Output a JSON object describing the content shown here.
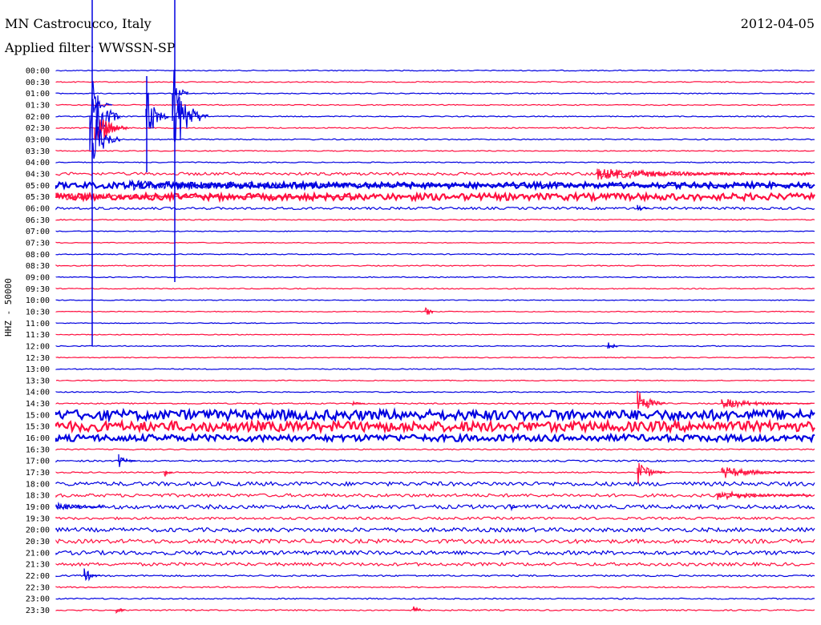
{
  "header": {
    "station": "MN Castrocucco, Italy",
    "filter": "Applied filter: WWSSN-SP",
    "date": "2012-04-05",
    "channel_label": "HHZ - 50000"
  },
  "colors": {
    "trace_a": "#0000e0",
    "trace_b": "#ff1040"
  },
  "chart_data": {
    "type": "helicorder",
    "title": "MN Castrocucco, Italy",
    "subtitle": "Applied filter: WWSSN-SP",
    "date": "2012-04-05",
    "ylabel": "HHZ - 50000",
    "row_labels": [
      "00:00",
      "00:30",
      "01:00",
      "01:30",
      "02:00",
      "02:30",
      "03:00",
      "03:30",
      "04:00",
      "04:30",
      "05:00",
      "05:30",
      "06:00",
      "06:30",
      "07:00",
      "07:30",
      "08:00",
      "08:30",
      "09:00",
      "09:30",
      "10:00",
      "10:30",
      "11:00",
      "11:30",
      "12:00",
      "12:30",
      "13:00",
      "13:30",
      "14:00",
      "14:30",
      "15:00",
      "15:30",
      "16:00",
      "16:30",
      "17:00",
      "17:30",
      "18:00",
      "18:30",
      "19:00",
      "19:30",
      "20:00",
      "20:30",
      "21:00",
      "21:30",
      "22:00",
      "22:30",
      "23:00",
      "23:30"
    ],
    "noise_level": [
      0.6,
      0.6,
      0.6,
      0.6,
      0.6,
      0.7,
      0.7,
      0.6,
      0.6,
      1.8,
      3.5,
      4,
      1.5,
      0.6,
      0.5,
      0.5,
      0.6,
      0.6,
      0.6,
      0.6,
      0.5,
      0.5,
      0.5,
      0.5,
      0.6,
      0.5,
      0.6,
      0.5,
      0.6,
      0.7,
      6,
      6,
      4,
      0.7,
      1,
      0.8,
      2.5,
      2,
      2.5,
      1.5,
      2.5,
      2.5,
      2.5,
      2,
      1,
      0.8,
      0.8,
      0.8
    ]
  }
}
